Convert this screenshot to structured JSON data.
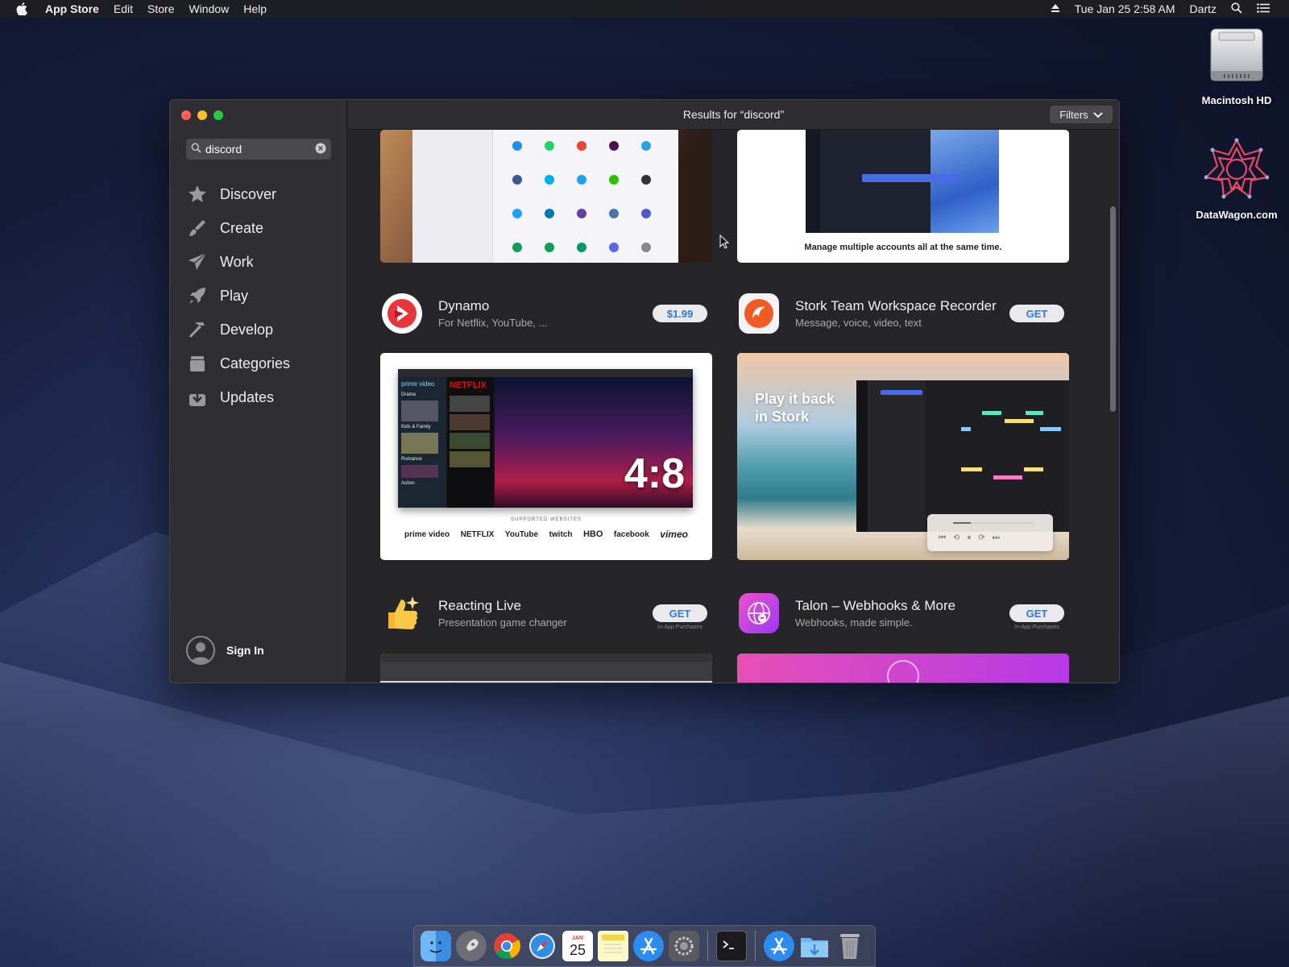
{
  "menubar": {
    "app_name": "App Store",
    "items": [
      "Edit",
      "Store",
      "Window",
      "Help"
    ],
    "datetime": "Tue Jan 25  2:58 AM",
    "user": "Dartz"
  },
  "desktop": {
    "icons": [
      {
        "label": "Macintosh HD"
      },
      {
        "label": "DataWagon.com"
      }
    ]
  },
  "window": {
    "title": "Results for “discord”",
    "filters_label": "Filters",
    "search": {
      "value": "discord"
    },
    "nav": [
      {
        "label": "Discover",
        "icon": "star-icon"
      },
      {
        "label": "Create",
        "icon": "brush-icon"
      },
      {
        "label": "Work",
        "icon": "paper-plane-icon"
      },
      {
        "label": "Play",
        "icon": "rocket-icon"
      },
      {
        "label": "Develop",
        "icon": "hammer-icon"
      },
      {
        "label": "Categories",
        "icon": "box-icon"
      },
      {
        "label": "Updates",
        "icon": "download-icon"
      }
    ],
    "sign_in_label": "Sign In"
  },
  "results": {
    "top_right_caption": "Manage multiple accounts all at the same time.",
    "apps": [
      {
        "name": "Dynamo",
        "subtitle": "For Netflix, YouTube, ...",
        "button": "$1.99",
        "iap": ""
      },
      {
        "name": "Stork Team Workspace Recorder",
        "subtitle": "Message, voice, video, text",
        "button": "GET",
        "iap": ""
      },
      {
        "name": "Reacting Live",
        "subtitle": "Presentation game changer",
        "button": "GET",
        "iap": "In-App Purchases"
      },
      {
        "name": "Talon – Webhooks & More",
        "subtitle": "Webhooks, made simple.",
        "button": "GET",
        "iap": "In-App Purchases"
      }
    ],
    "dynamo_shot": {
      "big_number": "4:8",
      "supported_label": "SUPPORTED WEBSITES",
      "sites": [
        "prime video",
        "NETFLIX",
        "YouTube",
        "twitch",
        "HBO",
        "facebook",
        "vimeo"
      ],
      "sidebar_words": [
        "prime video",
        "Drama",
        "Kids & Family",
        "Romance",
        "Action"
      ],
      "top_brand": "NETFLIX"
    },
    "stork_shot": {
      "headline_1": "Play it back",
      "headline_2": "in Stork"
    }
  },
  "colors": {
    "accent_blue": "#2a7ae2",
    "close": "#ff5f57",
    "minimize": "#febc2e",
    "zoom": "#28c840"
  },
  "dock": {
    "calendar_day": "25",
    "calendar_month": "JAN",
    "items": [
      "finder-icon",
      "launchpad-icon",
      "chrome-icon",
      "safari-icon",
      "calendar-icon",
      "notes-icon",
      "app-store-icon",
      "system-preferences-icon",
      "terminal-icon",
      "app-store-folder-icon",
      "downloads-folder-icon",
      "trash-icon"
    ]
  }
}
